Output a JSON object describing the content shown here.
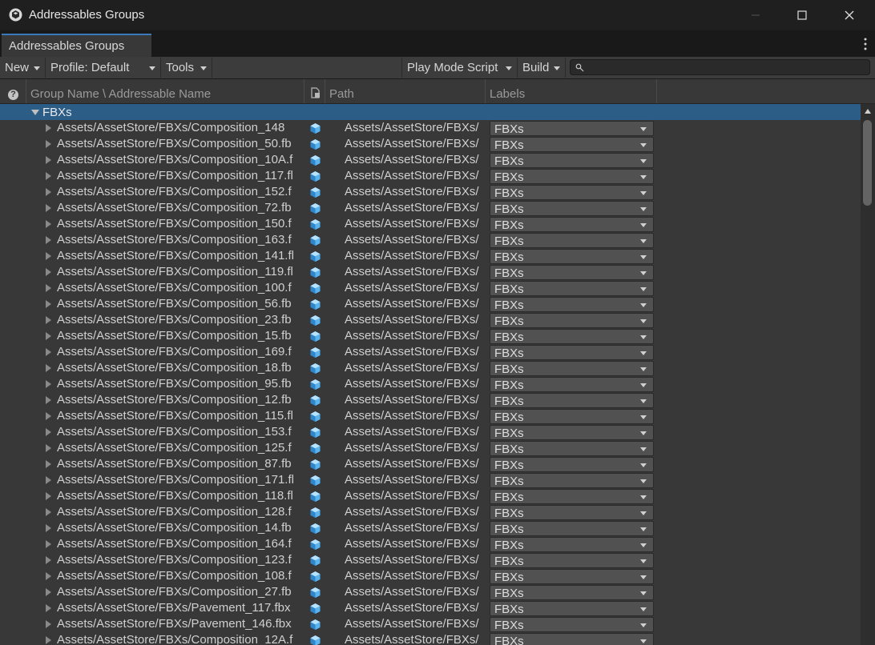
{
  "window": {
    "title": "Addressables Groups"
  },
  "tab": {
    "label": "Addressables Groups"
  },
  "toolbar": {
    "new_label": "New",
    "profile_label": "Profile: Default",
    "tools_label": "Tools",
    "play_mode_label": "Play Mode Script",
    "build_label": "Build",
    "search_value": ""
  },
  "columns": {
    "help": "?",
    "group_name": "Group Name \\ Addressable Name",
    "path": "Path",
    "labels": "Labels"
  },
  "group": {
    "name": "FBXs"
  },
  "rows": [
    {
      "name": "Assets/AssetStore/FBXs/Composition_148",
      "path": "Assets/AssetStore/FBXs/",
      "label": "FBXs"
    },
    {
      "name": "Assets/AssetStore/FBXs/Composition_50.fb",
      "path": "Assets/AssetStore/FBXs/",
      "label": "FBXs"
    },
    {
      "name": "Assets/AssetStore/FBXs/Composition_10A.f",
      "path": "Assets/AssetStore/FBXs/",
      "label": "FBXs"
    },
    {
      "name": "Assets/AssetStore/FBXs/Composition_117.fl",
      "path": "Assets/AssetStore/FBXs/",
      "label": "FBXs"
    },
    {
      "name": "Assets/AssetStore/FBXs/Composition_152.f",
      "path": "Assets/AssetStore/FBXs/",
      "label": "FBXs"
    },
    {
      "name": "Assets/AssetStore/FBXs/Composition_72.fb",
      "path": "Assets/AssetStore/FBXs/",
      "label": "FBXs"
    },
    {
      "name": "Assets/AssetStore/FBXs/Composition_150.f",
      "path": "Assets/AssetStore/FBXs/",
      "label": "FBXs"
    },
    {
      "name": "Assets/AssetStore/FBXs/Composition_163.f",
      "path": "Assets/AssetStore/FBXs/",
      "label": "FBXs"
    },
    {
      "name": "Assets/AssetStore/FBXs/Composition_141.fl",
      "path": "Assets/AssetStore/FBXs/",
      "label": "FBXs"
    },
    {
      "name": "Assets/AssetStore/FBXs/Composition_119.fl",
      "path": "Assets/AssetStore/FBXs/",
      "label": "FBXs"
    },
    {
      "name": "Assets/AssetStore/FBXs/Composition_100.f",
      "path": "Assets/AssetStore/FBXs/",
      "label": "FBXs"
    },
    {
      "name": "Assets/AssetStore/FBXs/Composition_56.fb",
      "path": "Assets/AssetStore/FBXs/",
      "label": "FBXs"
    },
    {
      "name": "Assets/AssetStore/FBXs/Composition_23.fb",
      "path": "Assets/AssetStore/FBXs/",
      "label": "FBXs"
    },
    {
      "name": "Assets/AssetStore/FBXs/Composition_15.fb",
      "path": "Assets/AssetStore/FBXs/",
      "label": "FBXs"
    },
    {
      "name": "Assets/AssetStore/FBXs/Composition_169.f",
      "path": "Assets/AssetStore/FBXs/",
      "label": "FBXs"
    },
    {
      "name": "Assets/AssetStore/FBXs/Composition_18.fb",
      "path": "Assets/AssetStore/FBXs/",
      "label": "FBXs"
    },
    {
      "name": "Assets/AssetStore/FBXs/Composition_95.fb",
      "path": "Assets/AssetStore/FBXs/",
      "label": "FBXs"
    },
    {
      "name": "Assets/AssetStore/FBXs/Composition_12.fb",
      "path": "Assets/AssetStore/FBXs/",
      "label": "FBXs"
    },
    {
      "name": "Assets/AssetStore/FBXs/Composition_115.fl",
      "path": "Assets/AssetStore/FBXs/",
      "label": "FBXs"
    },
    {
      "name": "Assets/AssetStore/FBXs/Composition_153.f",
      "path": "Assets/AssetStore/FBXs/",
      "label": "FBXs"
    },
    {
      "name": "Assets/AssetStore/FBXs/Composition_125.f",
      "path": "Assets/AssetStore/FBXs/",
      "label": "FBXs"
    },
    {
      "name": "Assets/AssetStore/FBXs/Composition_87.fb",
      "path": "Assets/AssetStore/FBXs/",
      "label": "FBXs"
    },
    {
      "name": "Assets/AssetStore/FBXs/Composition_171.fl",
      "path": "Assets/AssetStore/FBXs/",
      "label": "FBXs"
    },
    {
      "name": "Assets/AssetStore/FBXs/Composition_118.fl",
      "path": "Assets/AssetStore/FBXs/",
      "label": "FBXs"
    },
    {
      "name": "Assets/AssetStore/FBXs/Composition_128.f",
      "path": "Assets/AssetStore/FBXs/",
      "label": "FBXs"
    },
    {
      "name": "Assets/AssetStore/FBXs/Composition_14.fb",
      "path": "Assets/AssetStore/FBXs/",
      "label": "FBXs"
    },
    {
      "name": "Assets/AssetStore/FBXs/Composition_164.f",
      "path": "Assets/AssetStore/FBXs/",
      "label": "FBXs"
    },
    {
      "name": "Assets/AssetStore/FBXs/Composition_123.f",
      "path": "Assets/AssetStore/FBXs/",
      "label": "FBXs"
    },
    {
      "name": "Assets/AssetStore/FBXs/Composition_108.f",
      "path": "Assets/AssetStore/FBXs/",
      "label": "FBXs"
    },
    {
      "name": "Assets/AssetStore/FBXs/Composition_27.fb",
      "path": "Assets/AssetStore/FBXs/",
      "label": "FBXs"
    },
    {
      "name": "Assets/AssetStore/FBXs/Pavement_117.fbx",
      "path": "Assets/AssetStore/FBXs/",
      "label": "FBXs"
    },
    {
      "name": "Assets/AssetStore/FBXs/Pavement_146.fbx",
      "path": "Assets/AssetStore/FBXs/",
      "label": "FBXs"
    },
    {
      "name": "Assets/AssetStore/FBXs/Composition_12A.f",
      "path": "Assets/AssetStore/FBXs/",
      "label": "FBXs"
    }
  ],
  "colors": {
    "accent": "#3a79bb",
    "selection": "#2c5d87",
    "panel": "#383838",
    "cube_icon": "#5ab4f0"
  },
  "icons": {
    "app": "unity-cube-logo-icon",
    "asset": "prefab-cube-icon",
    "search": "search-icon",
    "menu": "kebab-menu-icon"
  }
}
